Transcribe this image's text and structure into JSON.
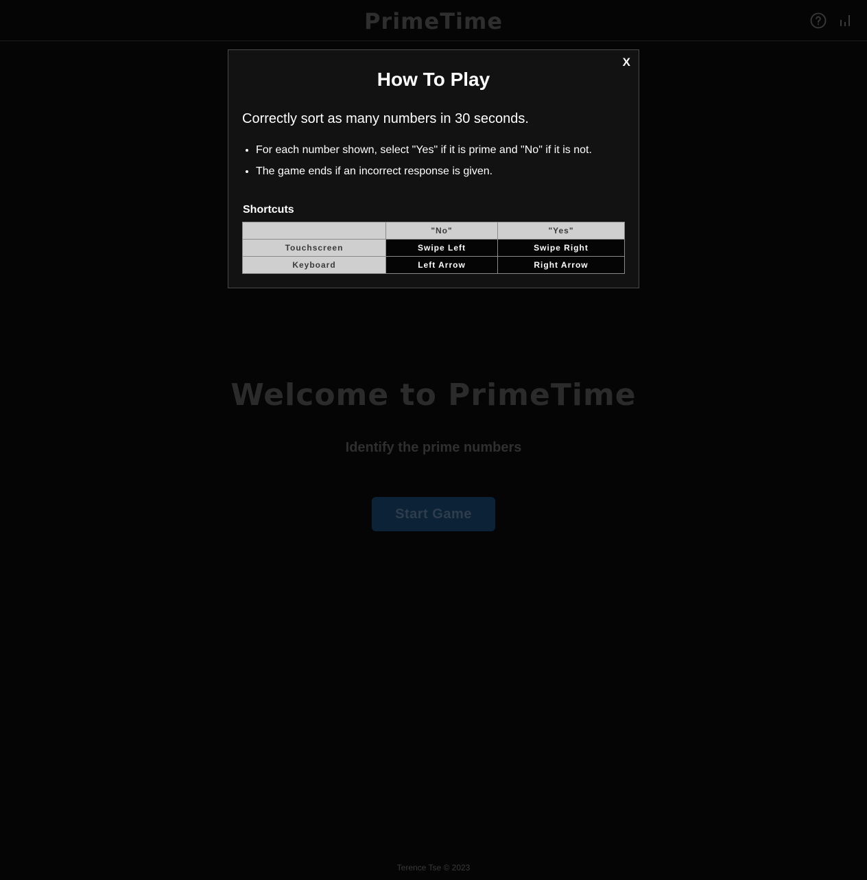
{
  "header": {
    "logo": "PrimeTime",
    "help_icon": "help-circle-icon",
    "stats_icon": "bar-chart-icon"
  },
  "main": {
    "title": "Welcome to PrimeTime",
    "subtitle": "Identify the prime numbers",
    "start_label": "Start Game"
  },
  "footer": {
    "text": "Terence Tse © 2023"
  },
  "modal": {
    "close_label": "X",
    "title": "How To Play",
    "lead": "Correctly sort as many numbers in 30 seconds.",
    "rules": [
      "For each number shown, select \"Yes\" if it is prime and \"No\" if it is not.",
      "The game ends if an incorrect response is given."
    ],
    "shortcuts_title": "Shortcuts",
    "table": {
      "headers": [
        "",
        "\"No\"",
        "\"Yes\""
      ],
      "rows": [
        {
          "label": "Touchscreen",
          "no": "Swipe Left",
          "yes": "Swipe Right"
        },
        {
          "label": "Keyboard",
          "no": "Left Arrow",
          "yes": "Right Arrow"
        }
      ]
    }
  },
  "colors": {
    "background": "#050505",
    "modal_background": "#121212",
    "start_button": "#0c2236",
    "table_header": "#cfcfcf"
  }
}
